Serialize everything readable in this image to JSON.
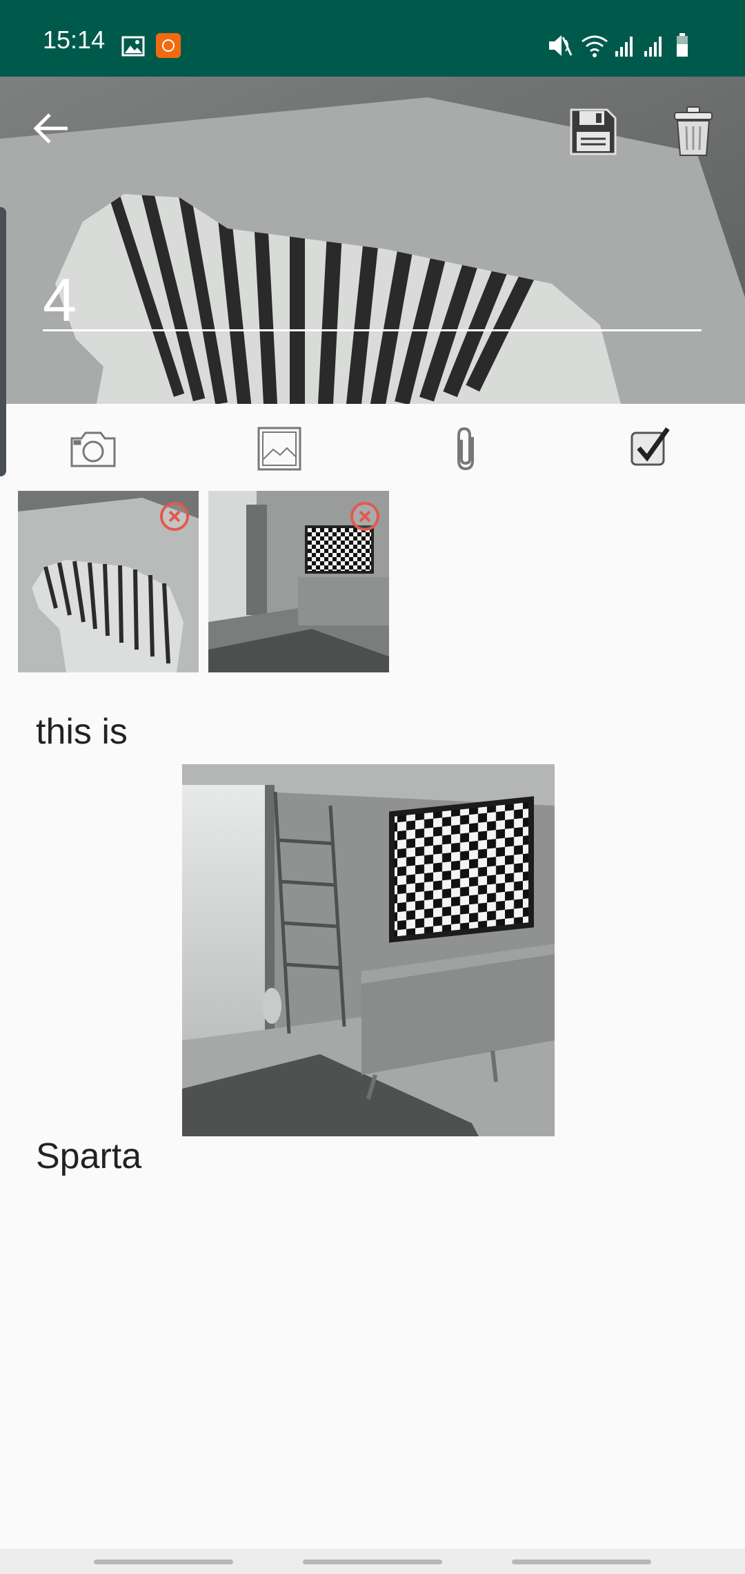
{
  "status_bar": {
    "time": "15:14",
    "icons": [
      "gallery-notification-icon",
      "app-notification-icon",
      "mute-icon",
      "wifi-icon",
      "signal-icon",
      "signal-icon",
      "battery-icon"
    ],
    "background_color": "#005a4c"
  },
  "header": {
    "title_value": "4",
    "actions": [
      "back-arrow-icon",
      "save-floppy-icon",
      "trash-icon"
    ]
  },
  "toolbar": {
    "items": [
      "camera-icon",
      "image-icon",
      "paperclip-icon",
      "checkbox-icon"
    ]
  },
  "attachments": {
    "items": [
      {
        "kind": "zebra-photo",
        "remove_icon": "remove-circle-icon"
      },
      {
        "kind": "room-photo",
        "remove_icon": "remove-circle-icon"
      }
    ],
    "remove_color": "#e05a4f"
  },
  "note": {
    "line1": "this is",
    "inline_image": "room-photo",
    "line2": "Sparta"
  }
}
